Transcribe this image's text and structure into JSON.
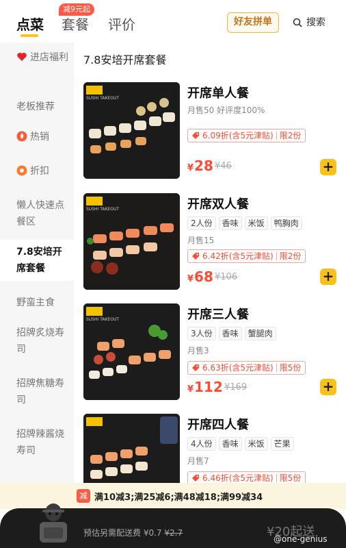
{
  "tabs": [
    {
      "label": "点菜"
    },
    {
      "label": "套餐"
    },
    {
      "label": "评价"
    }
  ],
  "promo_badge": "减9元起",
  "header": {
    "group_order": "好友拼单",
    "search": "搜索"
  },
  "sidebar": {
    "items": [
      {
        "label": "进店福利",
        "icon": "heart-icon"
      },
      {
        "label": "老板推荐"
      },
      {
        "label": "热销",
        "icon": "fire-icon"
      },
      {
        "label": "折扣",
        "icon": "discount-icon"
      },
      {
        "label": "懒人快速点餐区"
      },
      {
        "label": "7.8安培开席套餐"
      },
      {
        "label": "野蛮主食"
      },
      {
        "label": "招牌炙烧寿司"
      },
      {
        "label": "招牌焦糖寿司"
      },
      {
        "label": "招牌辣酱烧寿司"
      }
    ]
  },
  "section_title": "7.8安培开席套餐",
  "items": [
    {
      "name": "开席单人餐",
      "tags": [],
      "sales": "月售50 好评度100%",
      "discount": "6.09折(含5元津贴)",
      "limit": "限2份",
      "price": "28",
      "orig_price": "¥46"
    },
    {
      "name": "开席双人餐",
      "tags": [
        "2人份",
        "香味",
        "米饭",
        "鸭胸肉"
      ],
      "sales": "月售15",
      "discount": "6.42折(含5元津贴)",
      "limit": "限2份",
      "price": "68",
      "orig_price": "¥106"
    },
    {
      "name": "开席三人餐",
      "tags": [
        "3人份",
        "香味",
        "蟹腿肉"
      ],
      "sales": "月售3",
      "discount": "6.63折(含5元津贴)",
      "limit": "限5份",
      "price": "112",
      "orig_price": "¥169"
    },
    {
      "name": "开席四人餐",
      "tags": [
        "4人份",
        "香味",
        "米饭",
        "芒果"
      ],
      "sales": "月售7",
      "discount": "6.46折(含5元津贴)",
      "limit": "限5份",
      "price": "",
      "orig_price": ""
    }
  ],
  "thumb_brand": "SUSHI TAKEOUT",
  "promo_bar": {
    "badge": "减",
    "text": "满10减3;满25减6;满48减18;满99减34"
  },
  "cart": {
    "fee_label": "预估另需配送费",
    "fee": "¥0.7",
    "fee_orig": "¥2.7",
    "min_order": "¥20起送"
  },
  "watermark": "@one-genius",
  "colors": {
    "accent": "#f7c51e",
    "price": "#ff4b33",
    "promo": "#ff5a45"
  }
}
